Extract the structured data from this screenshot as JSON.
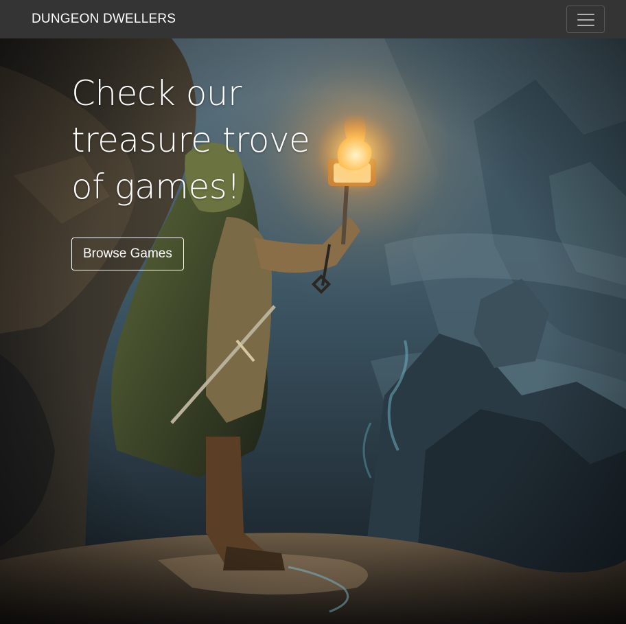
{
  "navbar": {
    "brand": "DUNGEON DWELLERS",
    "toggler_icon": "hamburger-menu-icon"
  },
  "hero": {
    "title": "Check our treasure trove of games!",
    "cta_label": "Browse Games",
    "background": "painted illustration: cloaked adventurer holding a lit lantern in a misty cave",
    "colors": {
      "navbar_bg": "#343434",
      "text": "#ffffff",
      "lantern_glow": "#ffb347",
      "mist": "#5f7c8c"
    }
  }
}
